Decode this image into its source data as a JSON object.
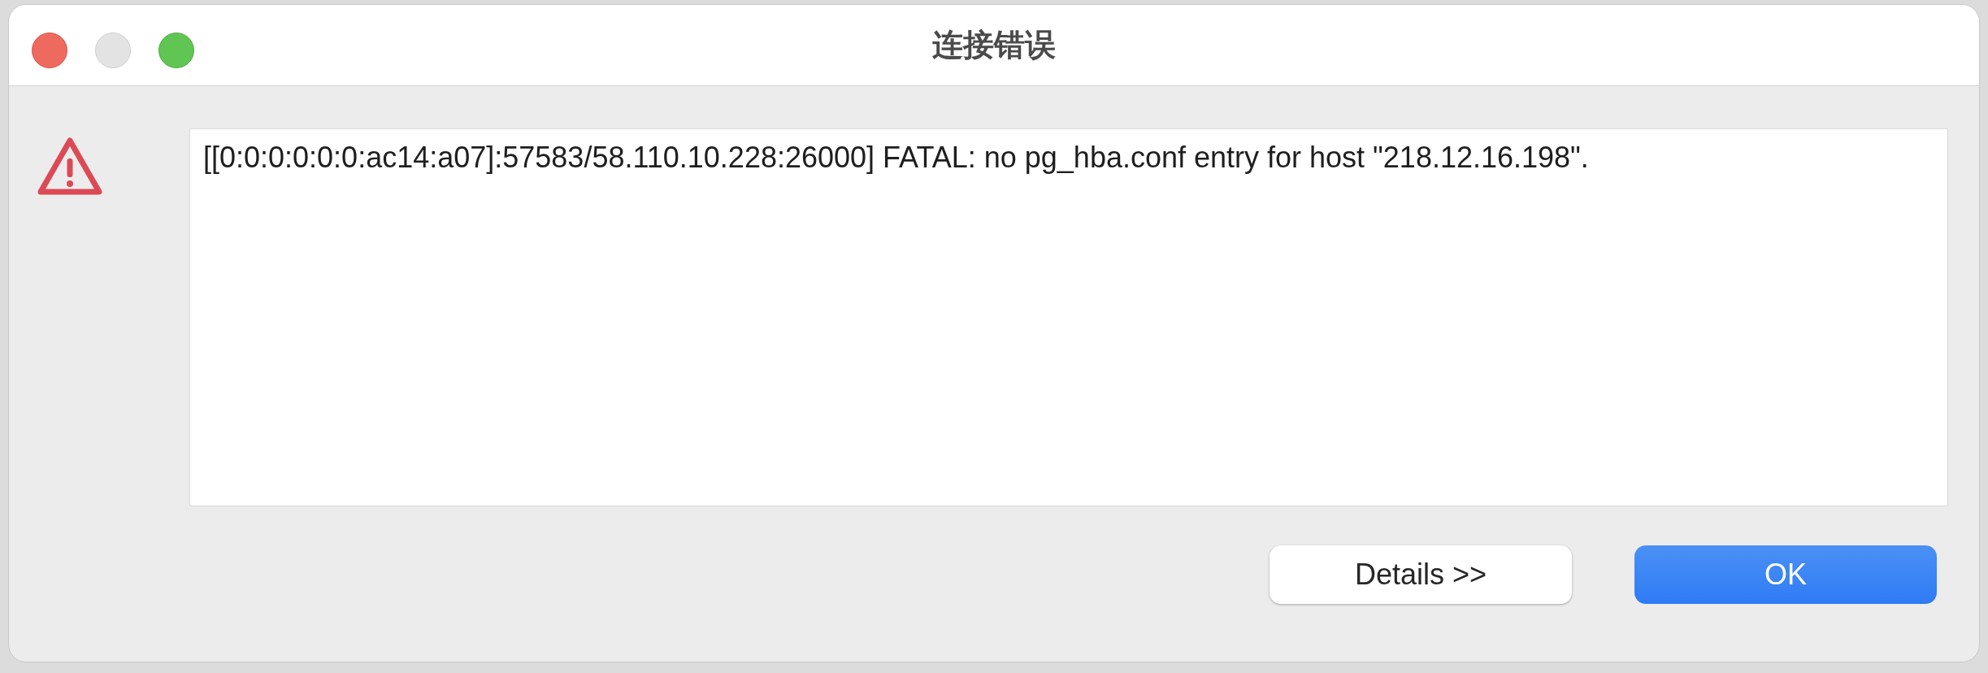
{
  "window": {
    "title": "连接错误"
  },
  "message": "[[0:0:0:0:0:0:ac14:a07]:57583/58.110.10.228:26000] FATAL: no pg_hba.conf entry for host \"218.12.16.198\".",
  "buttons": [
    {
      "label": "Details >>",
      "kind": "secondary"
    },
    {
      "label": "OK",
      "kind": "primary"
    }
  ]
}
